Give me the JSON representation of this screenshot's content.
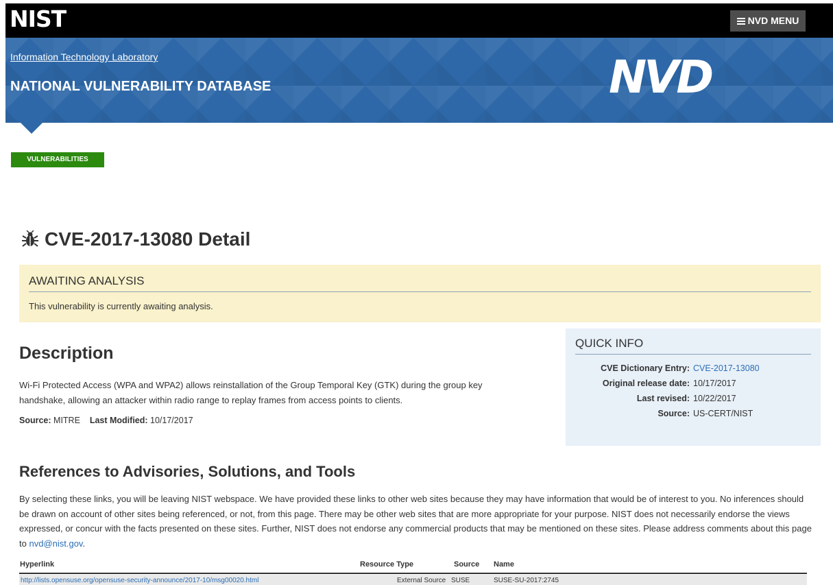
{
  "header": {
    "logo_text": "NIST",
    "menu_label": "NVD MENU",
    "itl_link": "Information Technology Laboratory",
    "site_title": "NATIONAL VULNERABILITY DATABASE",
    "nvd_logo": "NVD"
  },
  "breadcrumb": {
    "label": "VULNERABILITIES"
  },
  "page": {
    "title": "CVE-2017-13080 Detail"
  },
  "awaiting": {
    "heading": "AWAITING ANALYSIS",
    "text": "This vulnerability is currently awaiting analysis."
  },
  "description": {
    "heading": "Description",
    "text": "Wi-Fi Protected Access (WPA and WPA2) allows reinstallation of the Group Temporal Key (GTK) during the group key handshake, allowing an attacker within radio range to replay frames from access points to clients.",
    "source_label": "Source:",
    "source_value": "MITRE",
    "modified_label": "Last Modified:",
    "modified_value": "10/17/2017"
  },
  "quick_info": {
    "heading": "QUICK INFO",
    "rows": [
      {
        "label": "CVE Dictionary Entry:",
        "value": "CVE-2017-13080"
      },
      {
        "label": "Original release date:",
        "value": "10/17/2017"
      },
      {
        "label": "Last revised:",
        "value": "10/22/2017"
      },
      {
        "label": "Source:",
        "value": "US-CERT/NIST"
      }
    ]
  },
  "references": {
    "heading": "References to Advisories, Solutions, and Tools",
    "text_before": "By selecting these links, you will be leaving NIST webspace. We have provided these links to other web sites because they may have information that would be of interest to you. No inferences should be drawn on account of other sites being referenced, or not, from this page. There may be other web sites that are more appropriate for your purpose. NIST does not necessarily endorse the views expressed, or concur with the facts presented on these sites. Further, NIST does not endorse any commercial products that may be mentioned on these sites. Please address comments about this page to ",
    "email": "nvd@nist.gov",
    "text_after": ".",
    "columns": [
      "Hyperlink",
      "Resource Type",
      "Source",
      "Name"
    ],
    "rows": [
      {
        "hyperlink": "http://lists.opensuse.org/opensuse-security-announce/2017-10/msg00020.html",
        "resource_type": "External Source",
        "source": "SUSE",
        "name": "SUSE-SU-2017:2745"
      }
    ]
  },
  "colors": {
    "banner_blue": "#2e68a8",
    "breadcrumb_green": "#2c8a0f",
    "awaiting_bg": "#faf2cc",
    "quickinfo_bg": "#e8f0f8",
    "link": "#2b6eb5"
  }
}
